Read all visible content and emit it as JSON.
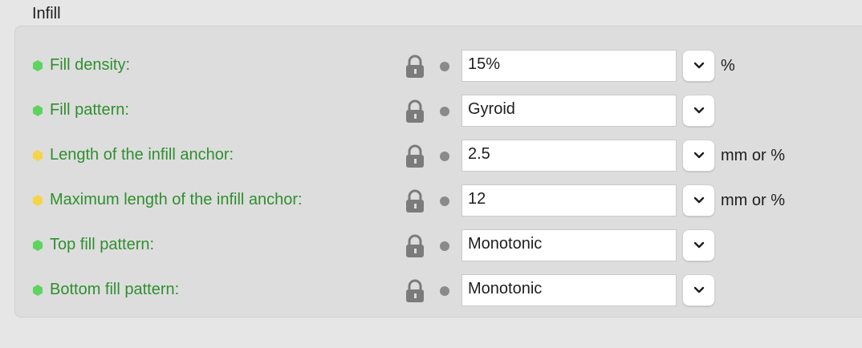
{
  "section": {
    "title": "Infill"
  },
  "colors": {
    "label_text": "#2f8f2f",
    "mode_simple": "#5fd35f",
    "mode_advanced": "#f5d547"
  },
  "rows": [
    {
      "label": "Fill density:",
      "value": "15%",
      "unit": "%",
      "mode_icon": "green-hexagon-icon"
    },
    {
      "label": "Fill pattern:",
      "value": "Gyroid",
      "unit": "",
      "mode_icon": "green-hexagon-icon"
    },
    {
      "label": "Length of the infill anchor:",
      "value": "2.5",
      "unit": "mm or %",
      "mode_icon": "yellow-hexagon-icon"
    },
    {
      "label": "Maximum length of the infill anchor:",
      "value": "12",
      "unit": "mm or %",
      "mode_icon": "yellow-hexagon-icon"
    },
    {
      "label": "Top fill pattern:",
      "value": "Monotonic",
      "unit": "",
      "mode_icon": "green-hexagon-icon"
    },
    {
      "label": "Bottom fill pattern:",
      "value": "Monotonic",
      "unit": "",
      "mode_icon": "green-hexagon-icon"
    }
  ]
}
